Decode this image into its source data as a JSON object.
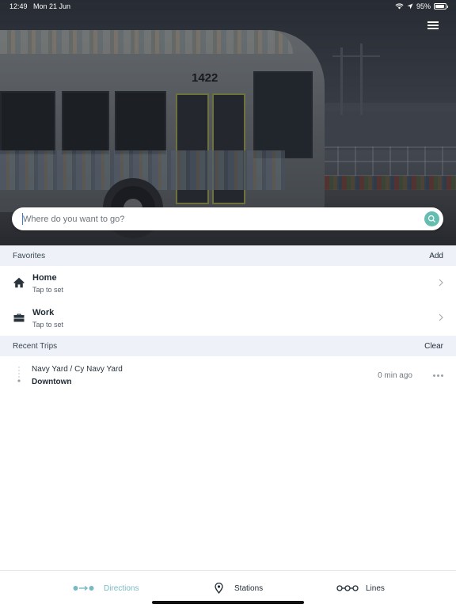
{
  "status_bar": {
    "time": "12:49",
    "date": "Mon 21 Jun",
    "battery": "95%",
    "icons": [
      "wifi-icon",
      "location-arrow-icon",
      "battery-icon"
    ]
  },
  "hero": {
    "bus_number": "1422",
    "menu_icon": "hamburger-menu-icon"
  },
  "search": {
    "placeholder": "Where do you want to go?",
    "value": "",
    "button_icon": "search-icon"
  },
  "favorites": {
    "title": "Favorites",
    "action": "Add",
    "items": [
      {
        "title": "Home",
        "subtitle": "Tap to set",
        "icon": "home-icon"
      },
      {
        "title": "Work",
        "subtitle": "Tap to set",
        "icon": "briefcase-icon"
      }
    ]
  },
  "recent_trips": {
    "title": "Recent Trips",
    "action": "Clear",
    "items": [
      {
        "route": "Navy Yard / Cy Navy Yard",
        "direction": "Downtown",
        "time_ago": "0 min ago"
      }
    ]
  },
  "tabs": [
    {
      "label": "Directions",
      "icon": "directions-icon",
      "active": true
    },
    {
      "label": "Stations",
      "icon": "map-pin-icon",
      "active": false
    },
    {
      "label": "Lines",
      "icon": "lines-icon",
      "active": false
    }
  ],
  "colors": {
    "accent": "#64bdb0",
    "active_tab": "#7ab9c2",
    "section_background": "#eef2f8"
  }
}
